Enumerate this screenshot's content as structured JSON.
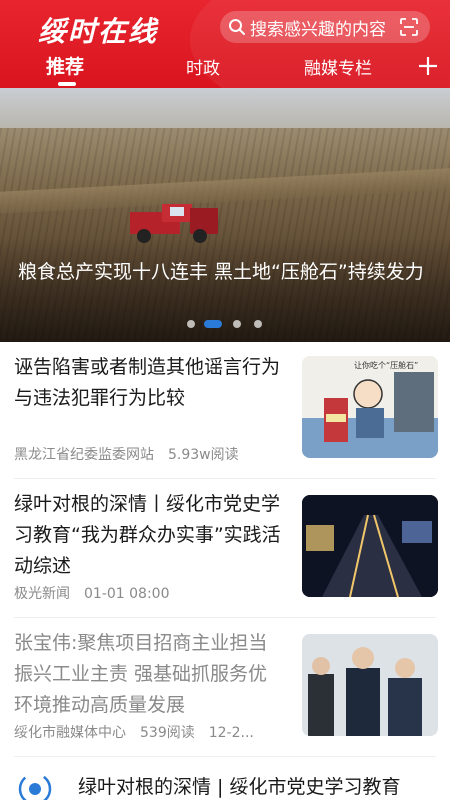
{
  "header": {
    "logo_text": "绥时在线",
    "search_placeholder": "搜索感兴趣的内容",
    "tabs": [
      {
        "label": "推荐"
      },
      {
        "label": "时政"
      },
      {
        "label": "融媒专栏"
      }
    ],
    "active_tab": "推荐"
  },
  "banner": {
    "caption": "粮食总产实现十八连丰 黑土地“压舱石”持续发力",
    "slide_count": 4,
    "active_slide": 2
  },
  "news": [
    {
      "title": "诬告陷害或者制造其他谣言行为与违法犯罪行为比较",
      "source": "黑龙江省纪委监委网站",
      "reads": "5.93w阅读",
      "thumb_caption": "让你吃个“压舱石”"
    },
    {
      "title": "绿叶对根的深情丨绥化市党史学习教育“我为群众办实事”实践活动综述",
      "source": "极光新闻",
      "time": "01-01 08:00"
    },
    {
      "title": "张宝伟:聚焦项目招商主业担当振兴工业主责 强基础抓服务优环境推动高质量发展",
      "source": "绥化市融媒体中心",
      "reads": "539阅读",
      "time": "12-2..."
    }
  ],
  "bottom_item": {
    "title": "绿叶对根的深情 | 绥化市党史学习教育"
  },
  "colors": {
    "brand_red": "#e8252f",
    "active_dot": "#2a7bd8",
    "meta_gray": "#8a8a8a"
  }
}
